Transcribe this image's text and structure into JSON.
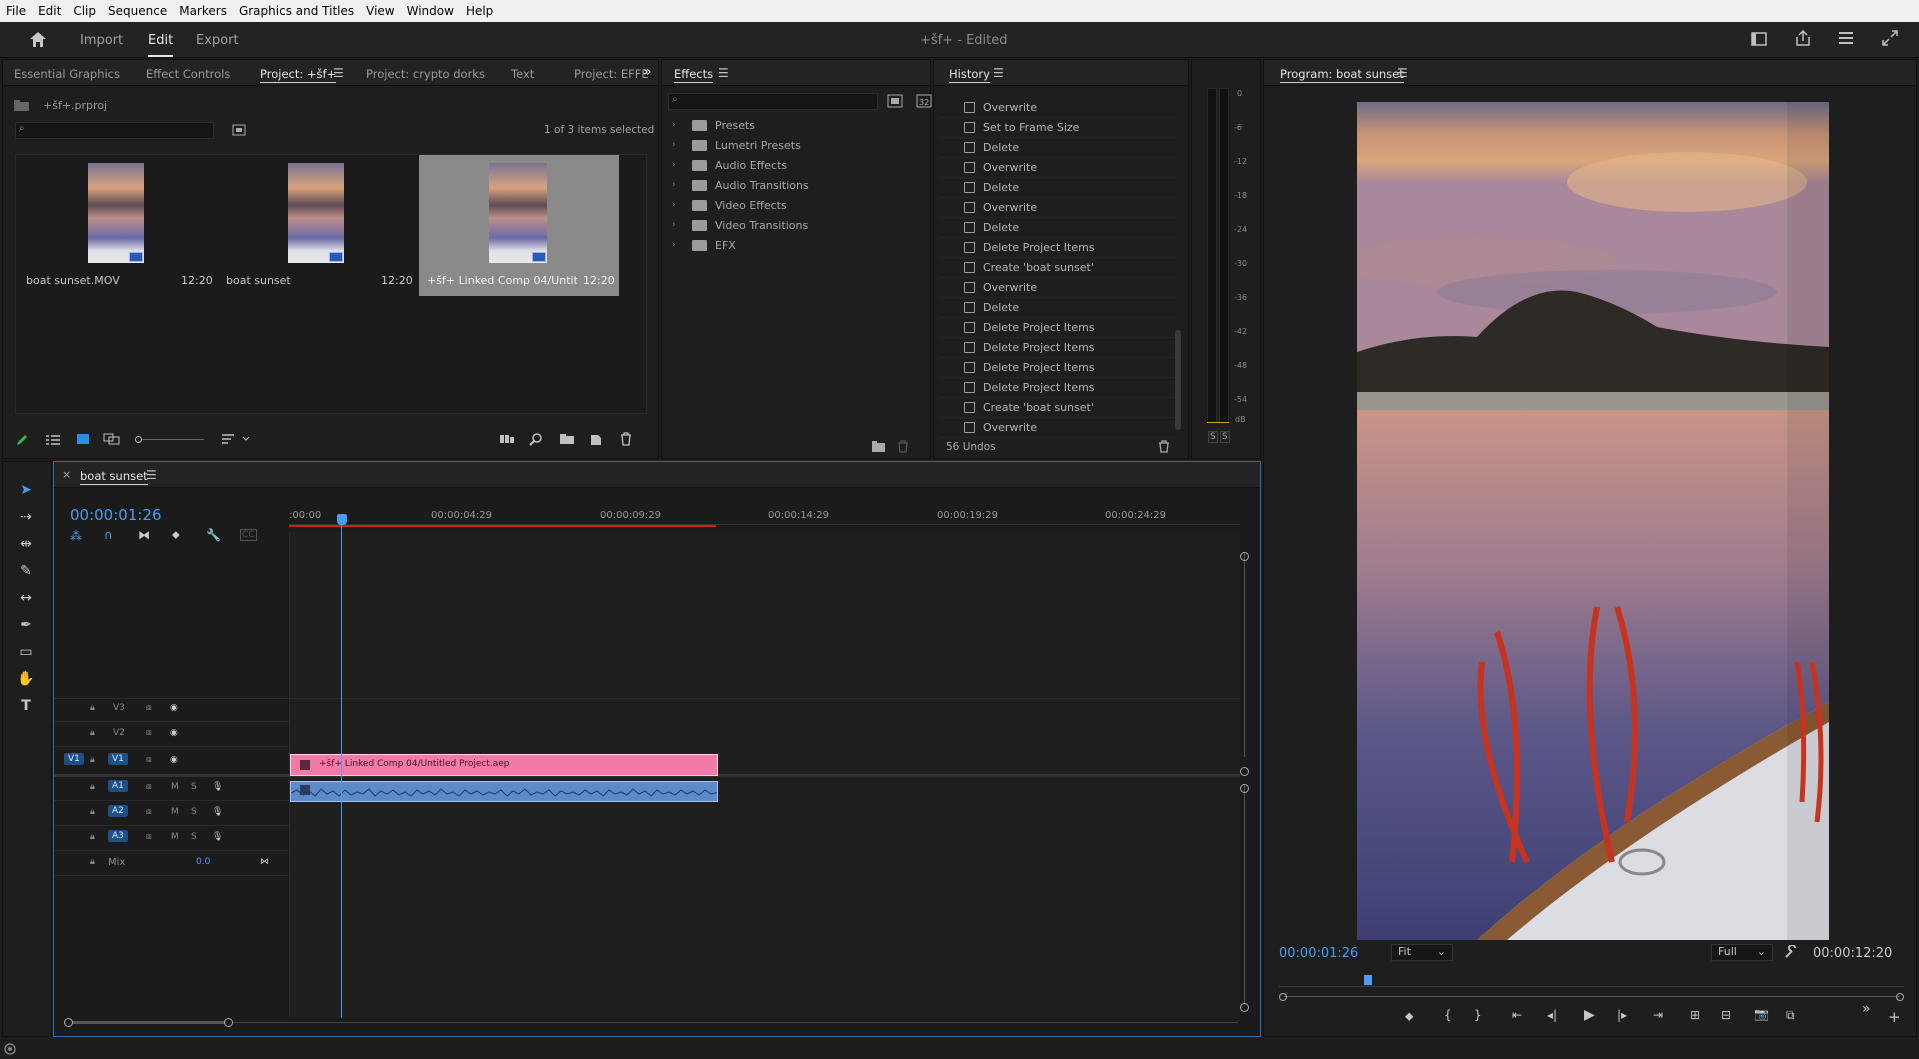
{
  "menubar": {
    "items": [
      "File",
      "Edit",
      "Clip",
      "Sequence",
      "Markers",
      "Graphics and Titles",
      "View",
      "Window",
      "Help"
    ]
  },
  "topbar": {
    "home_label": "",
    "workspaces": [
      "Import",
      "Edit",
      "Export"
    ],
    "active_workspace": "Edit",
    "title": "+šf+",
    "edited": " - Edited"
  },
  "project_panel": {
    "tabs": [
      "Essential Graphics",
      "Effect Controls",
      "Project: +šf+",
      "Project: crypto dorks",
      "Text",
      "Project: EFFE"
    ],
    "overflow": "»",
    "filename": "+šf+.prproj",
    "selection_info": "1 of 3 items selected",
    "items": [
      {
        "name": "boat sunset.MOV",
        "duration": "12:20"
      },
      {
        "name": "boat sunset",
        "duration": "12:20"
      },
      {
        "name": "+šf+ Linked Comp 04/Untit...",
        "duration": "12:20"
      }
    ]
  },
  "effects_panel": {
    "title": "Effects",
    "folders": [
      "Presets",
      "Lumetri Presets",
      "Audio Effects",
      "Audio Transitions",
      "Video Effects",
      "Video Transitions",
      "EFX"
    ]
  },
  "history_panel": {
    "title": "History",
    "items": [
      "Overwrite",
      "Set to Frame Size",
      "Delete",
      "Overwrite",
      "Delete",
      "Overwrite",
      "Delete",
      "Delete Project Items",
      "Create 'boat sunset'",
      "Overwrite",
      "Delete",
      "Delete Project Items",
      "Delete Project Items",
      "Delete Project Items",
      "Delete Project Items",
      "Create 'boat sunset'",
      "Overwrite"
    ],
    "undos": "56 Undos"
  },
  "meter": {
    "scale": [
      "0",
      "-6",
      "-12",
      "-18",
      "-24",
      "-30",
      "-36",
      "-42",
      "-48",
      "-54",
      "dB"
    ],
    "solo": [
      "S",
      "S"
    ]
  },
  "program_monitor": {
    "title": "Program: boat sunset",
    "timecode": "00:00:01:26",
    "fit": "Fit",
    "quality": "Full",
    "duration": "00:00:12:20"
  },
  "timeline": {
    "sequence_name": "boat sunset",
    "timecode": "00:00:01:26",
    "ruler": [
      ":00:00",
      "00:00:04:29",
      "00:00:09:29",
      "00:00:14:29",
      "00:00:19:29",
      "00:00:24:29"
    ],
    "video_tracks": [
      "V3",
      "V2",
      "V1"
    ],
    "source_patch": "V1",
    "audio_tracks": [
      "A1",
      "A2",
      "A3"
    ],
    "audio_buttons": [
      "M",
      "S"
    ],
    "mix_label": "Mix",
    "mix_value": "0.0",
    "clip_name": "+šf+ Linked Comp 04/Untitled Project.aep"
  },
  "colors": {
    "accent": "#2d8ceb",
    "clip_video": "#f279a8",
    "clip_audio": "#5d8ac8",
    "playhead": "#4a9cf0"
  }
}
